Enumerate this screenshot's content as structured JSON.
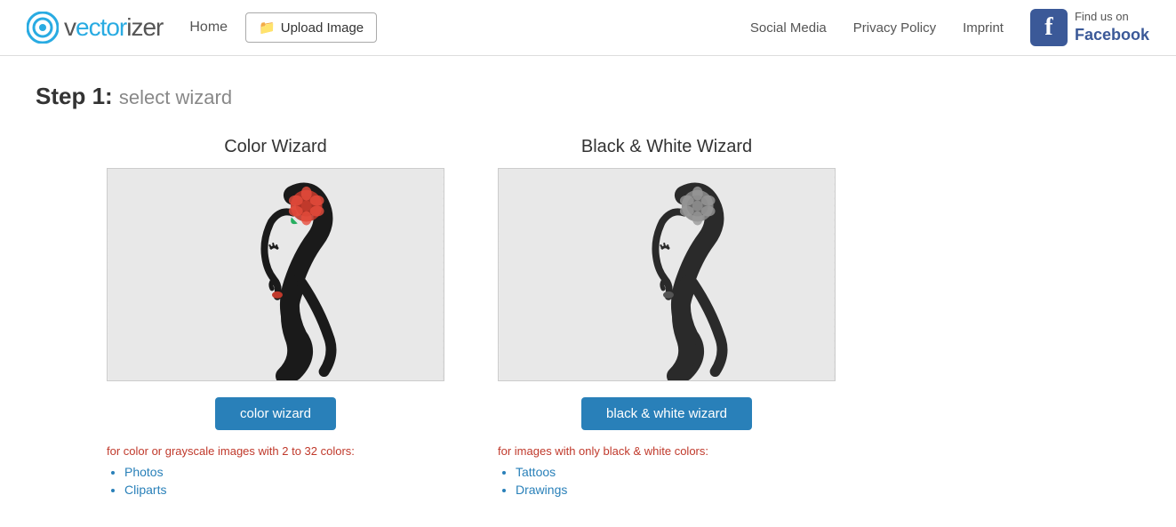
{
  "header": {
    "logo_text": "vectorizer",
    "home_label": "Home",
    "upload_label": "Upload Image",
    "nav": {
      "social_media": "Social Media",
      "privacy_policy": "Privacy Policy",
      "imprint": "Imprint"
    },
    "facebook": {
      "find": "Find us on",
      "name": "Facebook"
    }
  },
  "step": {
    "number": "Step 1:",
    "subtitle": "select wizard"
  },
  "color_wizard": {
    "title": "Color Wizard",
    "button_label": "color wizard",
    "description": "for color or grayscale images with 2 to 32 colors:",
    "list_items": [
      "Photos",
      "Cliparts"
    ]
  },
  "bw_wizard": {
    "title": "Black & White Wizard",
    "button_label": "black & white wizard",
    "description": "for images with only black & white colors:",
    "list_items": [
      "Tattoos",
      "Drawings"
    ]
  }
}
